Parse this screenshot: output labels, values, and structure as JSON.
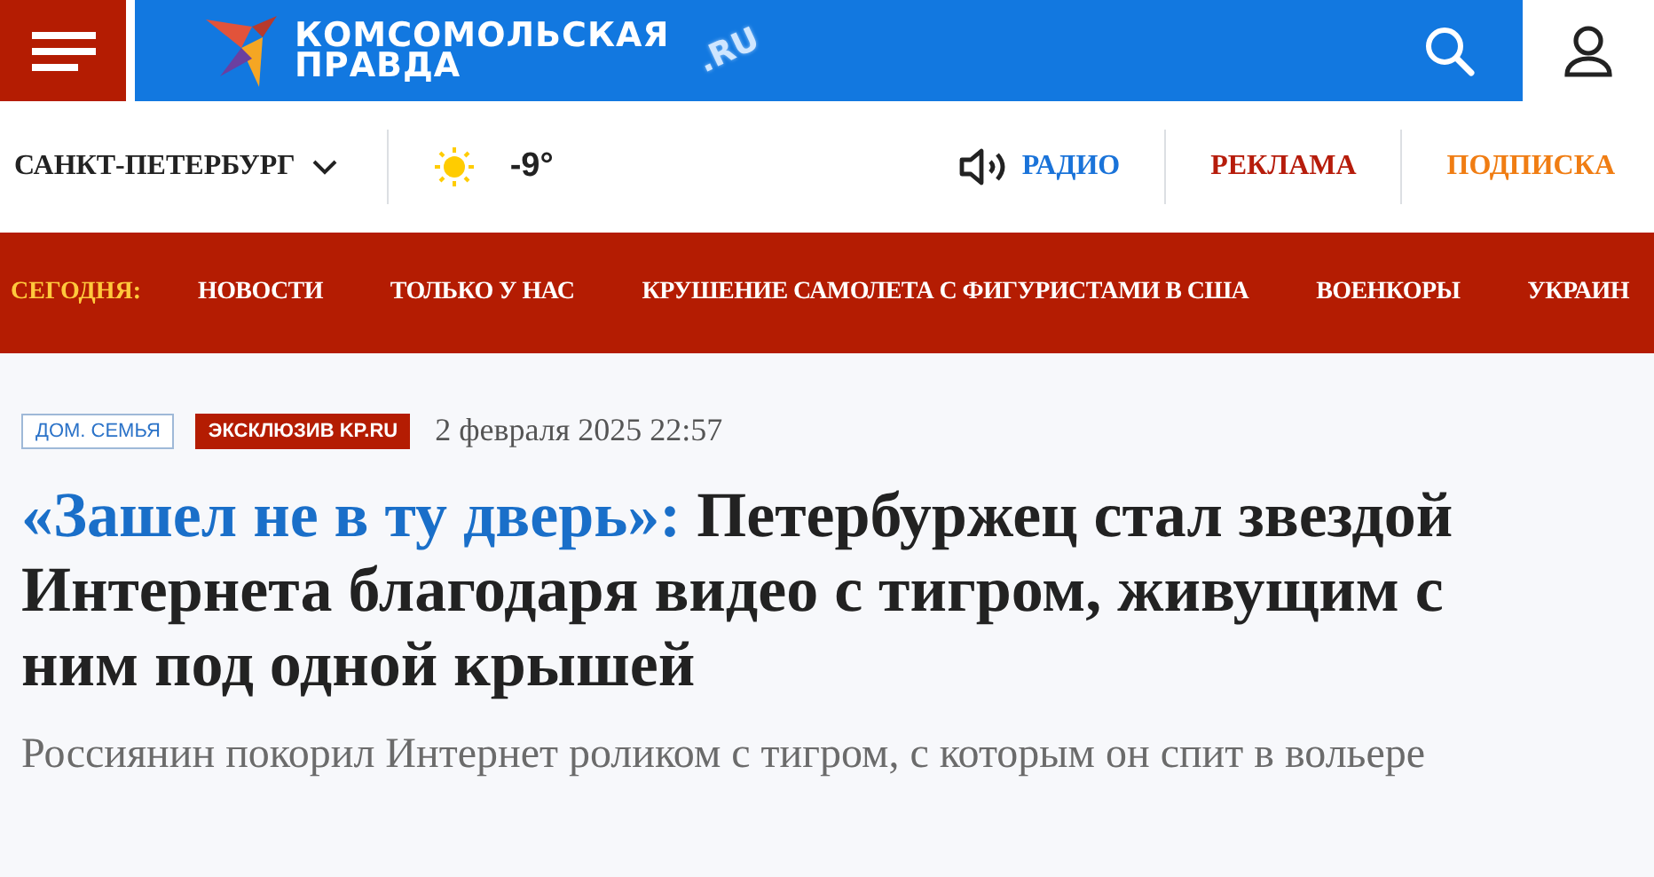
{
  "logo": {
    "line1": "КОМСОМОЛЬСКАЯ",
    "line2": "ПРАВДА",
    "domain": ".RU"
  },
  "city": "САНКТ-ПЕТЕРБУРГ",
  "temperature": "-9°",
  "links": [
    {
      "label": "РАДИО",
      "kind": "radio",
      "color": "#1a73d9"
    },
    {
      "label": "РЕКЛАМА",
      "kind": "plain",
      "color": "#b61c0b"
    },
    {
      "label": "ПОДПИСКА",
      "kind": "plain",
      "color": "#f07d13"
    }
  ],
  "nav": {
    "today": "СЕГОДНЯ:",
    "items": [
      "НОВОСТИ",
      "ТОЛЬКО У НАС",
      "КРУШЕНИЕ САМОЛЕТА С ФИГУРИСТАМИ В США",
      "ВОЕНКОРЫ",
      "УКРАИН"
    ]
  },
  "article": {
    "rubric": "ДОМ. СЕМЬЯ",
    "tag": "ЭКСКЛЮЗИВ KP.RU",
    "date": "2 февраля 2025 22:57",
    "headline_lead": "«Зашел не в ту дверь»:",
    "headline": "Петербуржец стал звездой Интернета благодаря видео с тигром, живущим с ним под одной крышей",
    "lede": "Россиянин покорил Интернет роликом с тигром, с которым он спит в вольере"
  }
}
